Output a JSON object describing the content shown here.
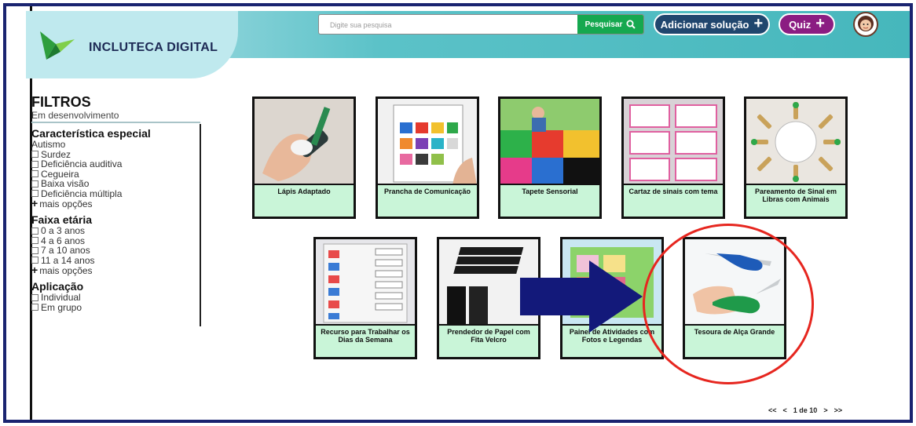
{
  "app": {
    "name": "INCLUTECA DIGITAL"
  },
  "search": {
    "placeholder": "Digite sua pesquisa",
    "button": "Pesquisar"
  },
  "actions": {
    "add_solution": "Adicionar solução",
    "quiz": "Quiz"
  },
  "filters": {
    "title": "FILTROS",
    "subtitle": "Em desenvolvimento",
    "sections": [
      {
        "title": "Característica especial",
        "header_item": "Autismo",
        "items": [
          "Surdez",
          "Deficiência auditiva",
          "Cegueira",
          "Baixa visão",
          "Deficiência múltipla"
        ],
        "more": "mais opções"
      },
      {
        "title": "Faixa etária",
        "items": [
          "0 a 3 anos",
          "4 a 6 anos",
          "7 a 10 anos",
          "11 a 14 anos"
        ],
        "more": "mais opções"
      },
      {
        "title": "Aplicação",
        "items": [
          "Individual",
          "Em grupo"
        ]
      }
    ]
  },
  "cards": [
    {
      "label": "Lápis Adaptado",
      "icon": "pencil-grip-photo"
    },
    {
      "label": "Prancha de Comunicação",
      "icon": "communication-board-photo"
    },
    {
      "label": "Tapete Sensorial",
      "icon": "sensory-mat-photo"
    },
    {
      "label": "Cartaz de sinais com tema",
      "icon": "signs-poster-photo"
    },
    {
      "label": "Pareamento de Sinal em Libras com Animais",
      "icon": "sign-matching-photo"
    },
    {
      "label": "Recurso para Trabalhar os Dias da Semana",
      "icon": "weekdays-board-photo"
    },
    {
      "label": "Prendedor de Papel com Fita Velcro",
      "icon": "velcro-clip-photo"
    },
    {
      "label": "Painel de Atividades com Fotos e Legendas",
      "icon": "activity-panel-photo"
    },
    {
      "label": "Tesoura de Alça Grande",
      "icon": "large-handle-scissors-photo"
    }
  ],
  "pagination": {
    "first": "<<",
    "prev": "<",
    "current": "1 de 10",
    "next": ">",
    "last": ">>"
  },
  "colors": {
    "header": "#46b7bc",
    "search_button": "#15a84f",
    "add_button": "#20466e",
    "quiz_button": "#8b1d82",
    "card_label_bg": "#c9f5d8",
    "highlight": "#e6261f",
    "arrow": "#13197a"
  }
}
